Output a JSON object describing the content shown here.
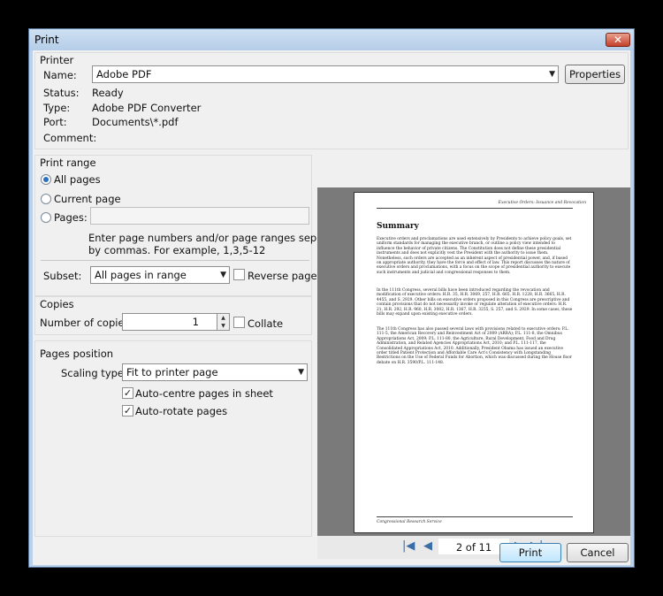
{
  "window": {
    "title": "Print"
  },
  "printer": {
    "group_label": "Printer",
    "name_label": "Name:",
    "name_value": "Adobe PDF",
    "properties_label": "Properties",
    "status_label": "Status:",
    "status_value": "Ready",
    "type_label": "Type:",
    "type_value": "Adobe PDF Converter",
    "port_label": "Port:",
    "port_value": "Documents\\*.pdf",
    "comment_label": "Comment:"
  },
  "print_range": {
    "group_label": "Print range",
    "all_pages": "All pages",
    "current_page": "Current page",
    "pages": "Pages:",
    "pages_value": "",
    "hint_line1": "Enter page numbers and/or page ranges separated",
    "hint_line2": "by commas. For example, 1,3,5-12",
    "subset_label": "Subset:",
    "subset_value": "All pages in range",
    "reverse_pages": "Reverse pages"
  },
  "copies": {
    "group_label": "Copies",
    "number_label": "Number of copies:",
    "number_value": "1",
    "collate": "Collate"
  },
  "pages_position": {
    "group_label": "Pages position",
    "scaling_label": "Scaling type:",
    "scaling_value": "Fit to printer page",
    "auto_centre": "Auto-centre pages in sheet",
    "auto_rotate": "Auto-rotate pages"
  },
  "preview": {
    "header": "Executive Orders: Issuance and Revocation",
    "title": "Summary",
    "p1": "Executive orders and proclamations are used extensively by Presidents to achieve policy goals, set uniform standards for managing the executive branch, or outline a policy view intended to influence the behavior of private citizens. The Constitution does not define these presidential instruments and does not explicitly vest the President with the authority to issue them. Nonetheless, such orders are accepted as an inherent aspect of presidential power, and, if based on appropriate authority, they have the force and effect of law. This report discusses the nature of executive orders and proclamations, with a focus on the scope of presidential authority to execute such instruments and judicial and congressional responses to them.",
    "p2": "In the 111th Congress, several bills have been introduced regarding the revocation and modification of executive orders: H.R. 35, H.R. 3069, 257, H.R. 665, H.R. 1228, H.R. 3665, H.R. 4455, and S. 2929. Other bills on executive orders proposed in this Congress are prescriptive and contain provisions that do not necessarily invoke or regulate alteration of executive orders: H.R. 21, H.R. 292, H.R. 960, H.R. 3082, H.R. 1367, H.R. 3255, S. 257, and S. 2929. In some cases, these bills may expand upon existing executive orders.",
    "p3": "The 111th Congress has also passed several laws with provisions related to executive orders: P.L. 111-5, the American Recovery and Reinvestment Act of 2009 (ARRA); P.L. 111-8, the Omnibus Appropriations Act, 2009; P.L. 111-80, the Agriculture, Rural Development, Food and Drug Administration, and Related Agencies Appropriations Act, 2010; and P.L. 111-117, the Consolidated Appropriations Act, 2010. Additionally, President Obama has issued an executive order titled Patient Protection and Affordable Care Act's Consistency with Longstanding Restrictions on the Use of Federal Funds for Abortion, which was discussed during the House floor debate on H.R. 3590/P.L. 111-148.",
    "footer": "Congressional Research Service"
  },
  "navigation": {
    "page_display": "2 of 11"
  },
  "actions": {
    "print_label": "Print",
    "cancel_label": "Cancel"
  }
}
